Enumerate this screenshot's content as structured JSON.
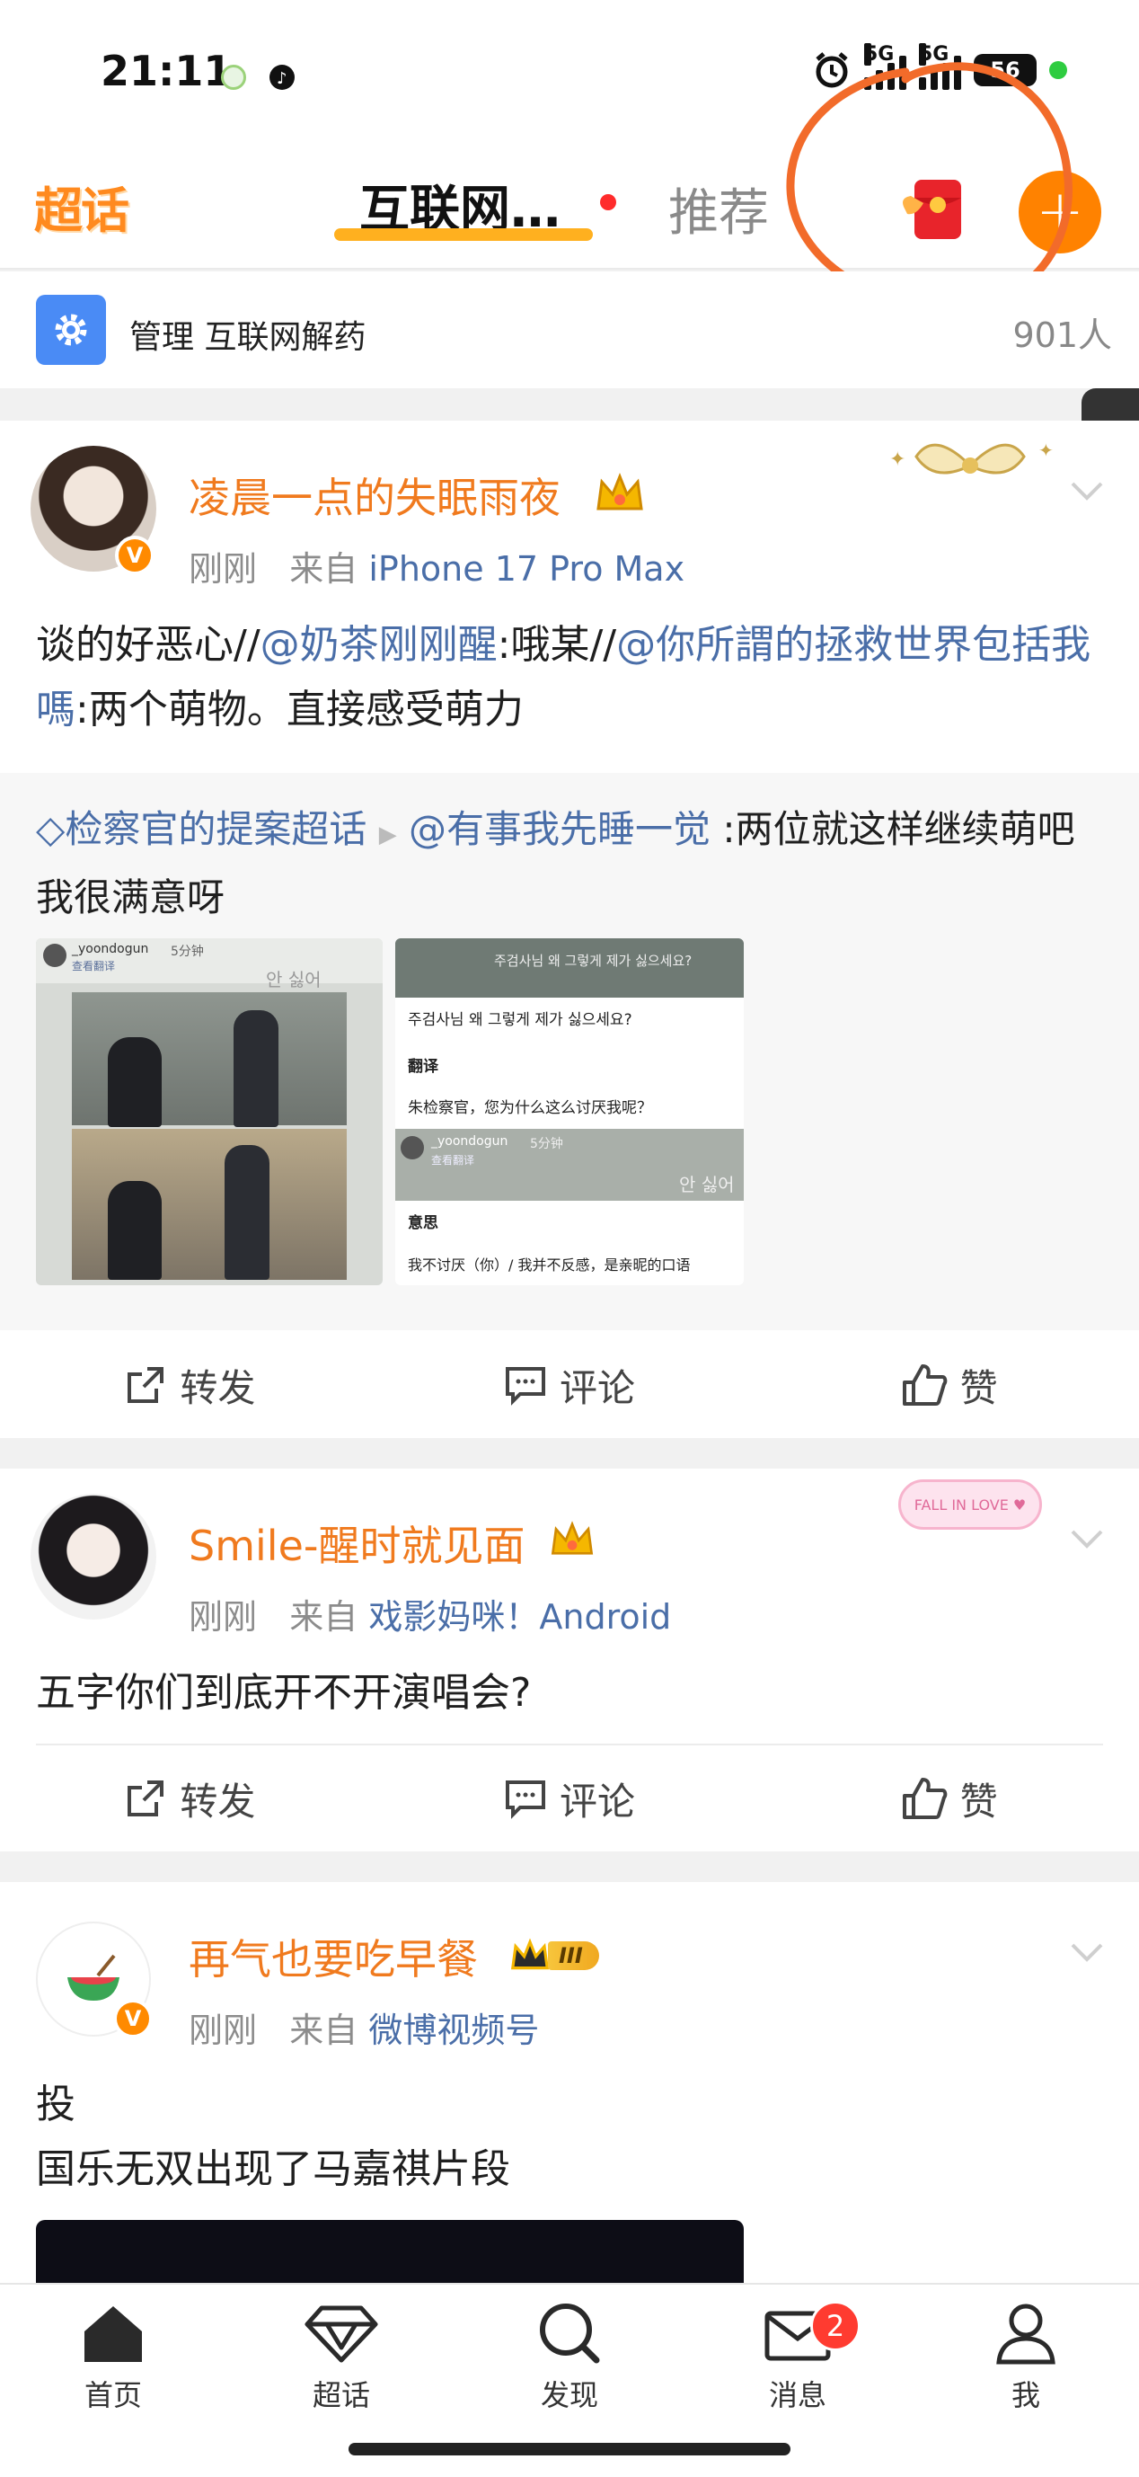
{
  "status_bar": {
    "time": "21:11",
    "network_1": "5G",
    "network_2": "5G",
    "battery": "56"
  },
  "nav": {
    "logo": "超话",
    "active_tab": "互联网…",
    "other_tab": "推荐",
    "add_label": "+"
  },
  "manage": {
    "text": "管理 互联网解药",
    "count": "901人"
  },
  "posts": [
    {
      "username": "凌晨一点的失眠雨夜",
      "time": "刚刚",
      "from": "来自",
      "source": "iPhone 17 Pro Max",
      "body_pre": "谈的好恶心//",
      "mention1": "@奶茶刚刚醒",
      "body_mid": ":哦某//",
      "mention2": "@你所謂的拯救世界包括我嗎",
      "body_post": ":两个萌物。直接感受萌力",
      "repost_topic": "检察官的提案超话",
      "repost_user": "@有事我先睡一觉",
      "repost_text": " :两位就这样继续萌吧 我很满意呀",
      "thumb1": {
        "handle": "_yoondogun",
        "time": "5分钟",
        "translate": "查看翻译",
        "overlay": "안 싫어"
      },
      "thumb2": {
        "kr_top": "주검사님 왜 그렇게 제가 싫으세요?",
        "kr_line": "주검사님 왜 그렇게 제가 싫으세요?",
        "translate_label": "翻译",
        "translation": "朱检察官，您为什么这么讨厌我呢？",
        "handle": "_yoondogun",
        "time": "5分钟",
        "translate": "查看翻译",
        "overlay": "안 싫어",
        "meaning_label": "意思",
        "meaning": "我不讨厌（你）/ 我并不反感，是亲昵的口语"
      }
    },
    {
      "username": "Smile-醒时就见面",
      "time": "刚刚",
      "from": "来自",
      "source": "戏影妈咪！Android",
      "body": "五字你们到底开不开演唱会?",
      "sticker": "FALL IN LOVE"
    },
    {
      "username": "再气也要吃早餐",
      "time": "刚刚",
      "from": "来自",
      "source": "微博视频号",
      "body_line1": "投",
      "body_line2": "国乐无双出现了马嘉祺片段",
      "level": "III"
    }
  ],
  "actions": {
    "repost": "转发",
    "comment": "评论",
    "like": "赞"
  },
  "bottom_nav": {
    "home": "首页",
    "super_topic": "超话",
    "discover": "发现",
    "messages": "消息",
    "messages_badge": "2",
    "me": "我"
  },
  "colors": {
    "accent": "#ff8200",
    "username": "#f07a1e",
    "link": "#4a6ea8",
    "annotation": "#f26b2a"
  }
}
